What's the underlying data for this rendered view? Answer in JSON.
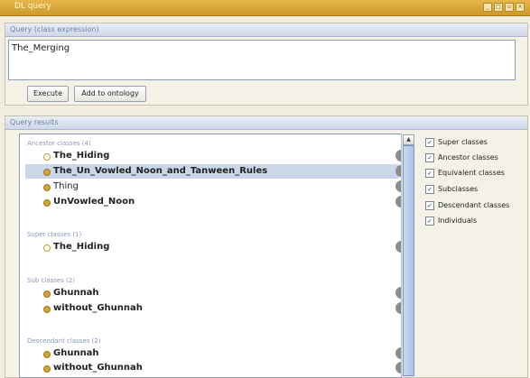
{
  "window": {
    "title": "DL query"
  },
  "query_panel": {
    "header": "Query (class expression)",
    "value": "The_Merging",
    "buttons": {
      "execute": "Execute",
      "add_to_ontology": "Add to ontology"
    }
  },
  "results_panel": {
    "header": "Query results",
    "sections": [
      {
        "title": "Ancestor classes (4)",
        "rows": [
          {
            "label": "The_Hiding",
            "icon": "class-hollow-icon",
            "bold": true,
            "selected": false
          },
          {
            "label": "The_Un_Vowled_Noon_and_Tanween_Rules",
            "icon": "class-icon",
            "bold": true,
            "selected": true
          },
          {
            "label": "Thing",
            "icon": "class-icon",
            "bold": false,
            "selected": false
          },
          {
            "label": "UnVowled_Noon",
            "icon": "class-icon",
            "bold": true,
            "selected": false
          }
        ]
      },
      {
        "title": "Super classes (1)",
        "rows": [
          {
            "label": "The_Hiding",
            "icon": "class-hollow-icon",
            "bold": true,
            "selected": false
          }
        ]
      },
      {
        "title": "Sub classes (2)",
        "rows": [
          {
            "label": "Ghunnah",
            "icon": "class-icon",
            "bold": true,
            "selected": false
          },
          {
            "label": "without_Ghunnah",
            "icon": "class-icon",
            "bold": true,
            "selected": false
          }
        ]
      },
      {
        "title": "Descendant classes (2)",
        "rows": [
          {
            "label": "Ghunnah",
            "icon": "class-icon",
            "bold": true,
            "selected": false
          },
          {
            "label": "without_Ghunnah",
            "icon": "class-icon",
            "bold": true,
            "selected": false
          }
        ]
      }
    ],
    "info_icon": "i",
    "options": [
      {
        "label": "Super classes",
        "checked": true
      },
      {
        "label": "Ancestor classes",
        "checked": true
      },
      {
        "label": "Equivalent classes",
        "checked": true
      },
      {
        "label": "Subclasses",
        "checked": true
      },
      {
        "label": "Descendant classes",
        "checked": true
      },
      {
        "label": "Individuals",
        "checked": true
      }
    ]
  },
  "colors": {
    "accent": "#cc9a2c",
    "selection": "#cbd6e8",
    "header_text": "#6d80a8"
  }
}
